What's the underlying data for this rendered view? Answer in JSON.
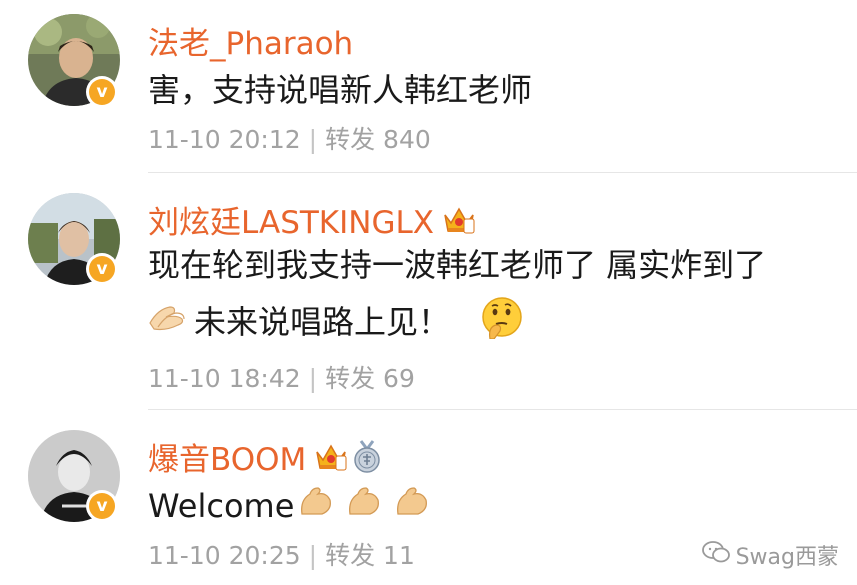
{
  "comments": [
    {
      "username": "法老_Pharaoh",
      "content_line1": "害，支持说唱新人韩红老师",
      "date": "11-10 20:12",
      "separator": "|",
      "repost_label": "转发",
      "repost_count": "840"
    },
    {
      "username": "刘炫廷LASTKINGLX",
      "content_line1": "现在轮到我支持一波韩红老师了 属实炸到了",
      "content_line2": "未来说唱路上见！",
      "date": "11-10 18:42",
      "separator": "|",
      "repost_label": "转发",
      "repost_count": "69"
    },
    {
      "username": "爆音BOOM",
      "content_line1": "Welcome",
      "date": "11-10 20:25",
      "separator": "|",
      "repost_label": "转发",
      "repost_count": "11"
    }
  ],
  "watermark": {
    "text": "Swag西蒙"
  },
  "colors": {
    "username": "#e8652d",
    "verified_badge": "#f6a623",
    "meta": "#a2a2a2"
  },
  "icons": [
    "verified-badge-icon",
    "crown-icon",
    "medal-icon",
    "clap-hands-emoji",
    "thinking-face-emoji",
    "flexed-biceps-emoji",
    "wechat-icon"
  ]
}
